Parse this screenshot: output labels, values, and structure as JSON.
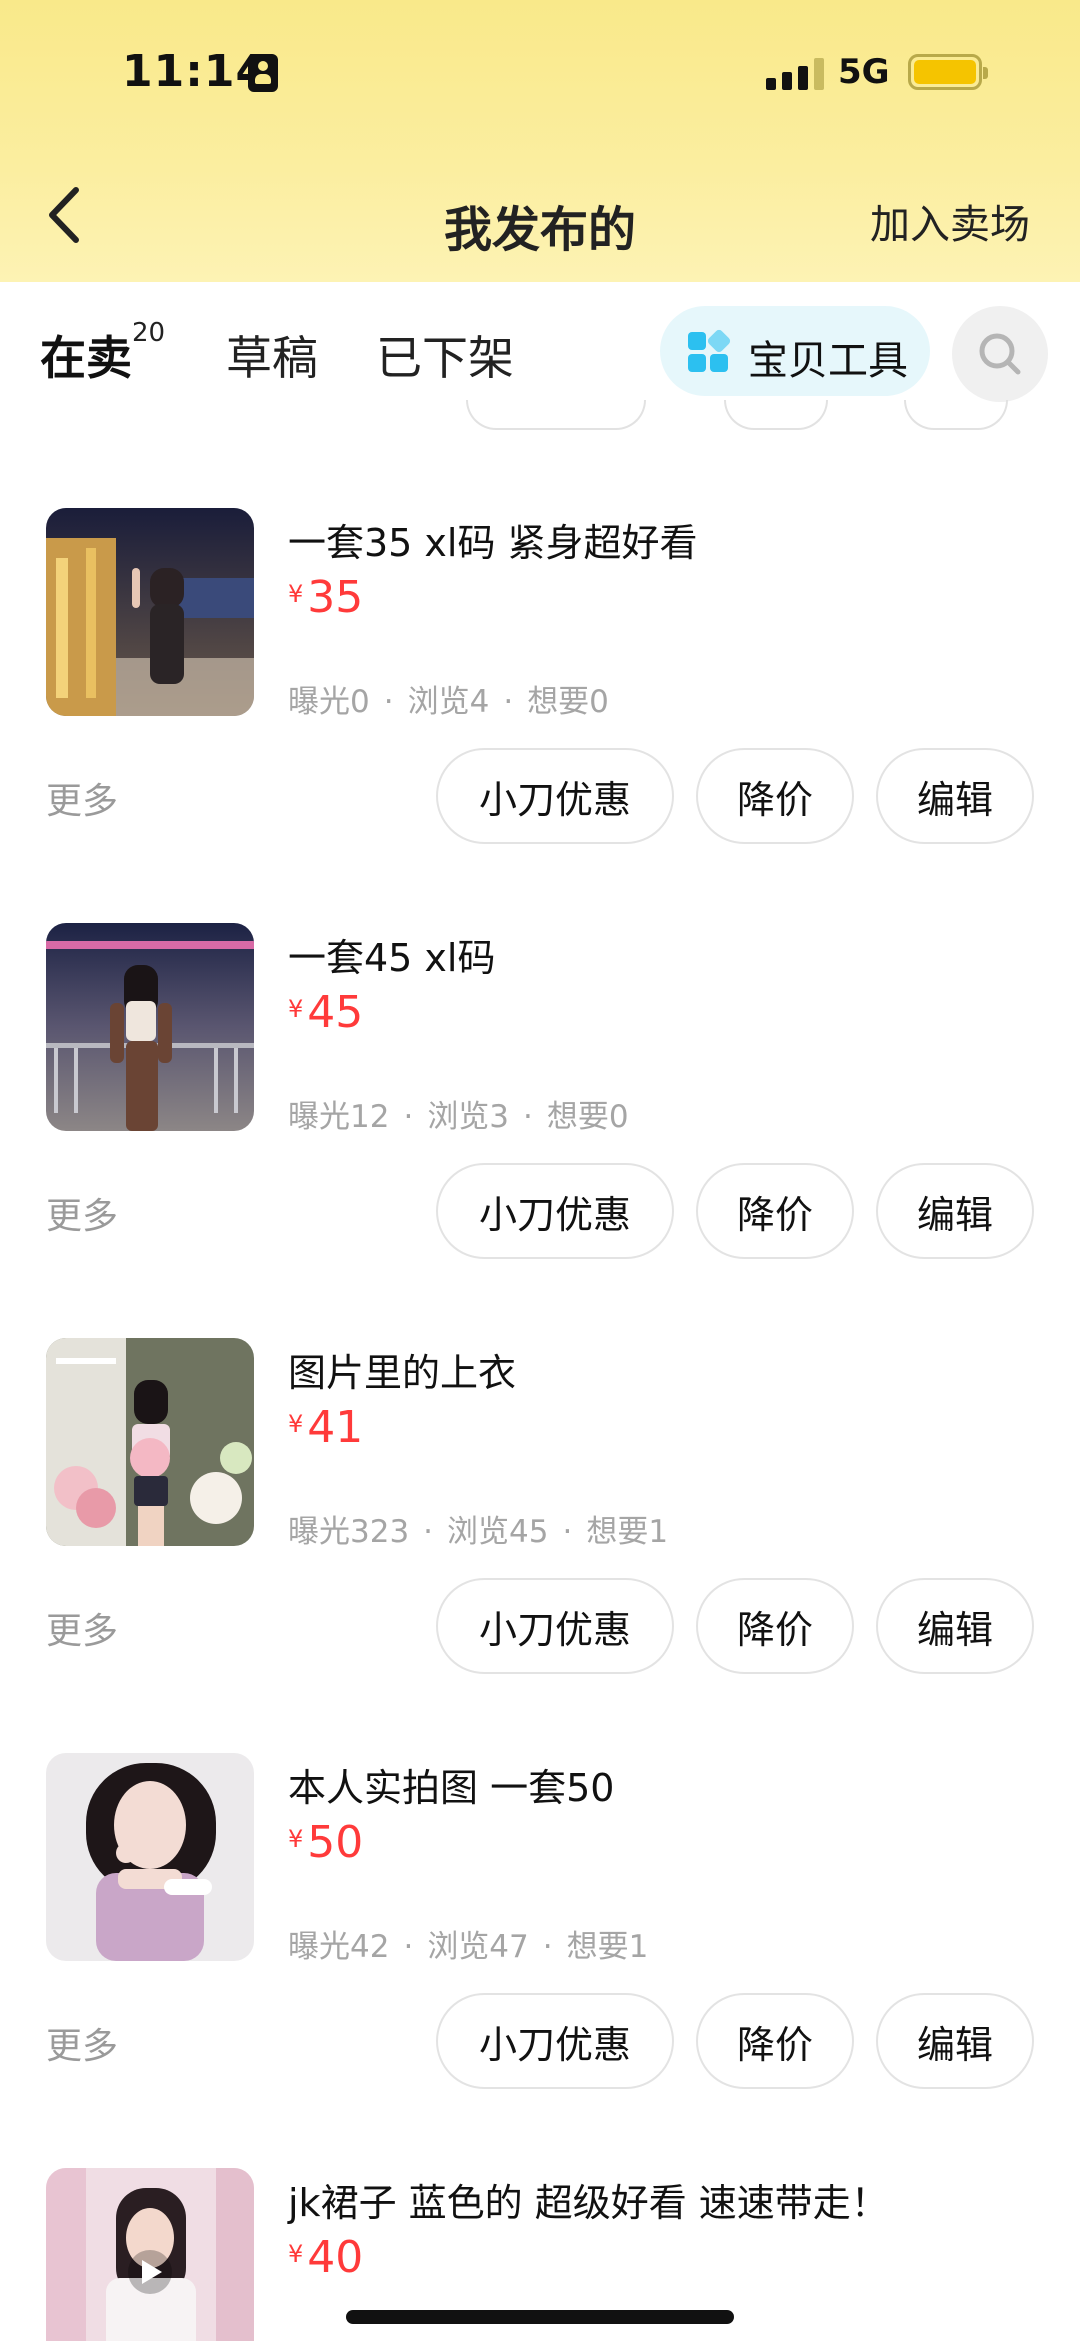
{
  "status_bar": {
    "time": "11:14",
    "network": "5G"
  },
  "nav": {
    "title": "我发布的",
    "right_action": "加入卖场"
  },
  "tabs": [
    {
      "label": "在卖",
      "badge": "20"
    },
    {
      "label": "草稿"
    },
    {
      "label": "已下架"
    }
  ],
  "toolbar": {
    "tool_label": "宝贝工具"
  },
  "action_labels": {
    "more": "更多",
    "knife_discount": "小刀优惠",
    "price_drop": "降价",
    "edit": "编辑"
  },
  "colors": {
    "accent_yellow": "#ffe60a",
    "price_red": "#ff3a3a",
    "header_bg": "#f9e98a"
  },
  "items": [
    {
      "title": "一套35 xl码 紧身超好看",
      "currency": "¥",
      "price": "35",
      "exposure": "曝光0",
      "views": "浏览4",
      "wants": "想要0"
    },
    {
      "title": "一套45 xl码",
      "currency": "¥",
      "price": "45",
      "exposure": "曝光12",
      "views": "浏览3",
      "wants": "想要0"
    },
    {
      "title": "图片里的上衣",
      "currency": "¥",
      "price": "41",
      "exposure": "曝光323",
      "views": "浏览45",
      "wants": "想要1"
    },
    {
      "title": "本人实拍图 一套50",
      "currency": "¥",
      "price": "50",
      "exposure": "曝光42",
      "views": "浏览47",
      "wants": "想要1"
    },
    {
      "title": "jk裙子 蓝色的 超级好看 速速带走！",
      "currency": "¥",
      "price": "40"
    }
  ]
}
